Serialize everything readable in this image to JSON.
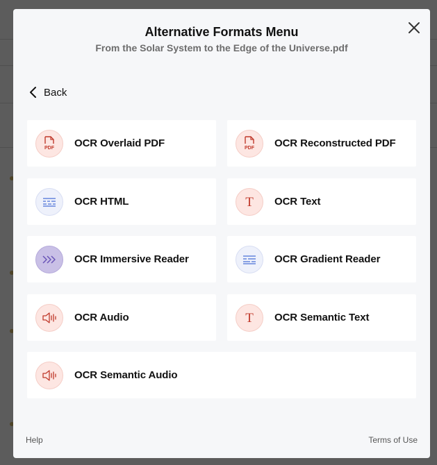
{
  "modal": {
    "title": "Alternative Formats Menu",
    "subtitle": "From the Solar System to the Edge of the Universe.pdf",
    "back_label": "Back"
  },
  "formats": [
    {
      "label": "OCR Overlaid PDF",
      "icon": "pdf-icon"
    },
    {
      "label": "OCR Reconstructed PDF",
      "icon": "pdf-icon"
    },
    {
      "label": "OCR HTML",
      "icon": "html-lines-icon"
    },
    {
      "label": "OCR Text",
      "icon": "text-t-icon"
    },
    {
      "label": "OCR Immersive Reader",
      "icon": "immersive-reader-icon"
    },
    {
      "label": "OCR Gradient Reader",
      "icon": "gradient-lines-icon"
    },
    {
      "label": "OCR Audio",
      "icon": "speaker-icon"
    },
    {
      "label": "OCR Semantic Text",
      "icon": "text-t-icon"
    },
    {
      "label": "OCR Semantic Audio",
      "icon": "speaker-icon"
    }
  ],
  "footer": {
    "help": "Help",
    "terms": "Terms of Use"
  },
  "colors": {
    "accent_red": "#c0392b",
    "accent_blue": "#4a6fd6",
    "accent_purple": "#6a55b8"
  }
}
